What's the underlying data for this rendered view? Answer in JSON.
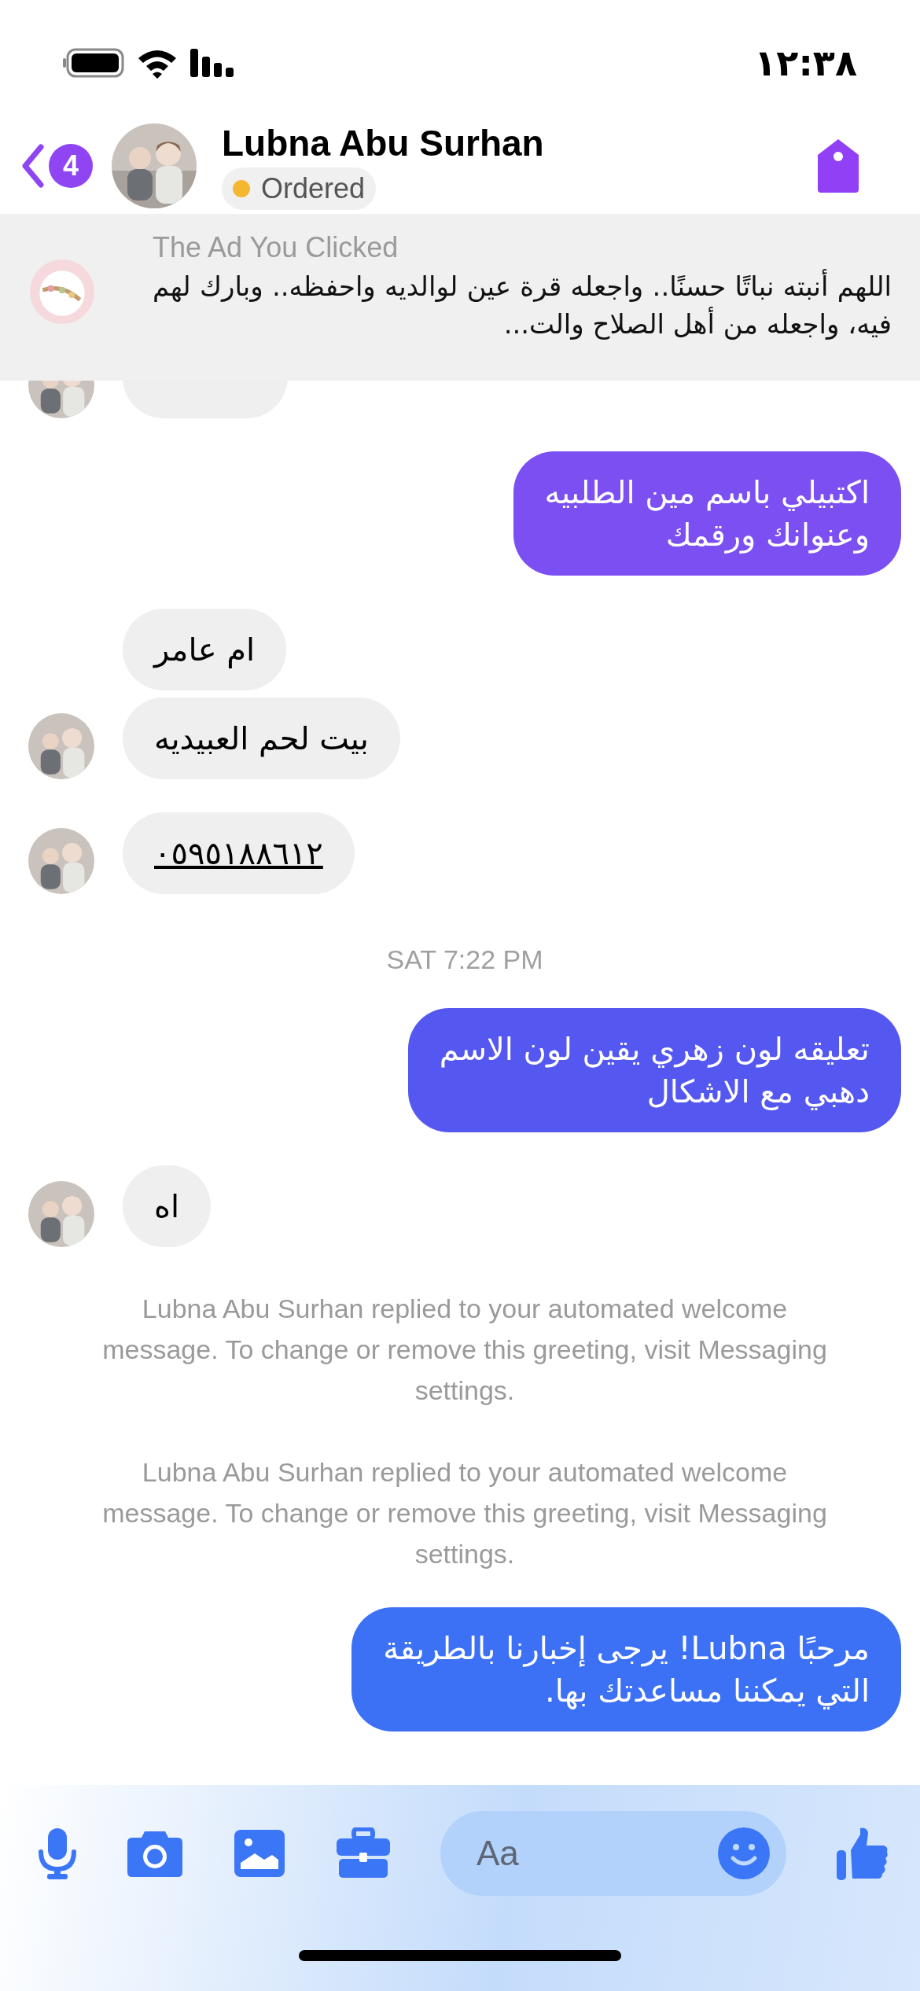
{
  "status_bar": {
    "time": "١٢:٣٨"
  },
  "header": {
    "back_badge": "4",
    "name": "Lubna Abu Surhan",
    "label": {
      "text": "Ordered",
      "color": "#f5b731"
    }
  },
  "ad": {
    "title": "The Ad You Clicked",
    "text": "اللهم أنبته نباتًا حسنًا.. واجعله قرة عين لوالديه واحفظه.. وبارك لهم فيه، واجعله من أهل الصلاح والت..."
  },
  "messages": [
    {
      "kind": "partial",
      "avatar": true
    },
    {
      "kind": "sent",
      "text": "اكتبيلي باسم مين الطلبيه\nوعنوانك ورقمك",
      "color": "#7b4ff1"
    },
    {
      "kind": "received",
      "text": "ام عامر",
      "avatar": false,
      "link": false
    },
    {
      "kind": "received",
      "text": "بيت لحم العبيديه",
      "avatar": true,
      "link": false
    },
    {
      "kind": "received",
      "text": "٠٥٩٥١٨٨٦١٢",
      "avatar": true,
      "link": true
    },
    {
      "kind": "timestamp",
      "text": "SAT 7:22 PM"
    },
    {
      "kind": "sent",
      "text": "تعليقه لون زهري يقين لون الاسم\nدهبي مع الاشكال",
      "color": "#5558f0"
    },
    {
      "kind": "received",
      "text": "اه",
      "avatar": true,
      "link": false
    },
    {
      "kind": "system",
      "text": "Lubna Abu Surhan replied to your automated welcome message. To change or remove this greeting, visit Messaging settings."
    },
    {
      "kind": "system",
      "text": "Lubna Abu Surhan replied to your automated welcome message. To change or remove this greeting, visit Messaging settings."
    },
    {
      "kind": "sent",
      "text": "مرحبًا Lubna! يرجى إخبارنا بالطريقة\nالتي يمكننا مساعدتك بها.",
      "color": "#3c70f5"
    }
  ],
  "composer": {
    "placeholder": "Aa"
  }
}
